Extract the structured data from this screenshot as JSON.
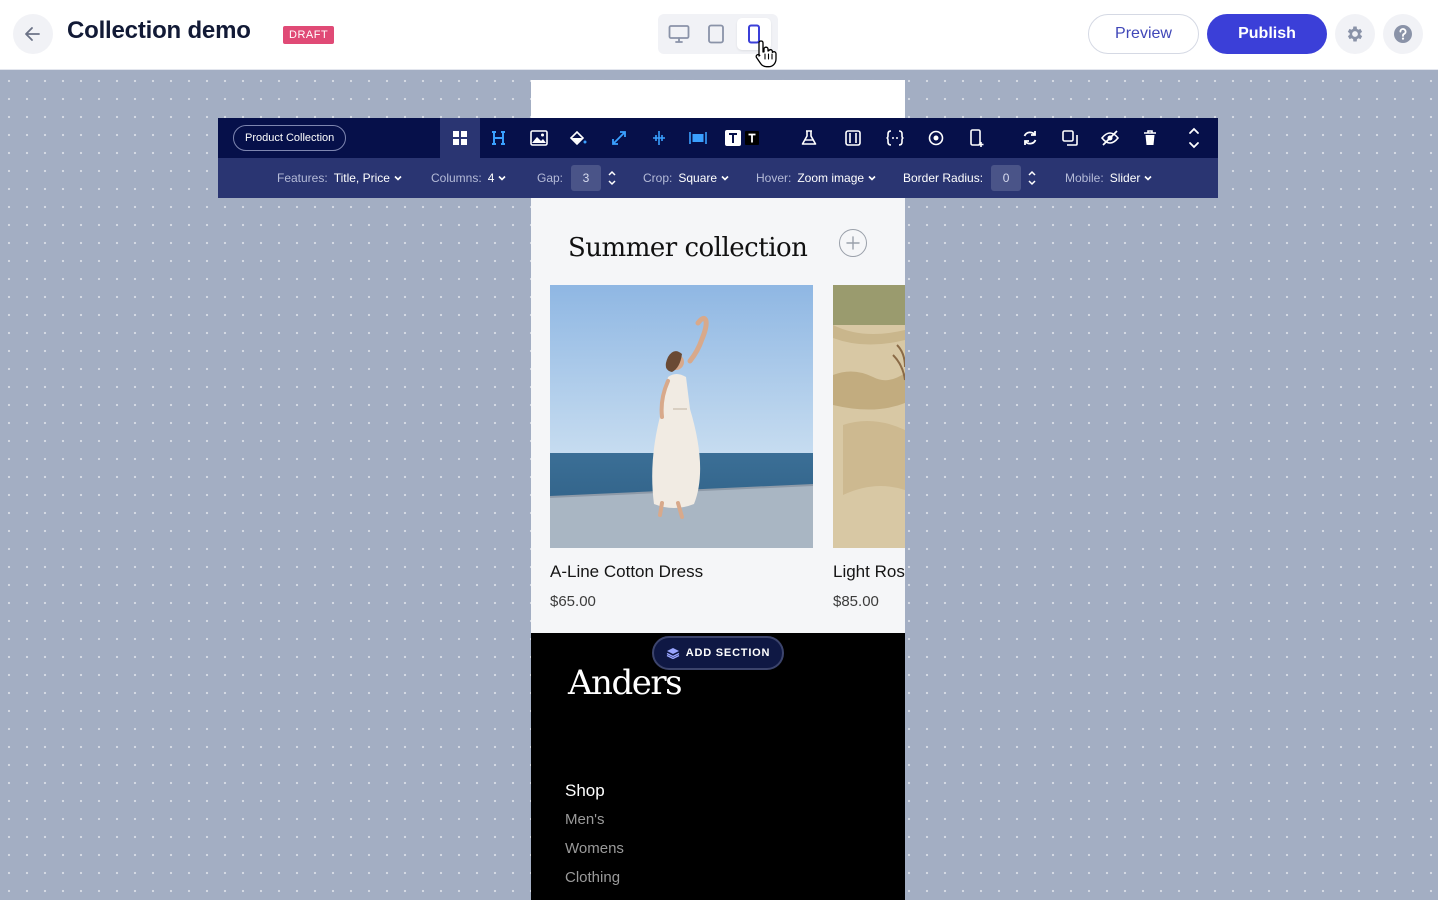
{
  "header": {
    "title": "Collection demo",
    "badge": "DRAFT",
    "preview_label": "Preview",
    "publish_label": "Publish",
    "devices": [
      "desktop-icon",
      "tablet-icon",
      "mobile-icon"
    ],
    "active_device": "mobile"
  },
  "toolbar": {
    "element_name": "Product Collection",
    "settings": {
      "features_label": "Features:",
      "features_value": "Title, Price",
      "columns_label": "Columns:",
      "columns_value": "4",
      "gap_label": "Gap:",
      "gap_value": "3",
      "crop_label": "Crop:",
      "crop_value": "Square",
      "hover_label": "Hover:",
      "hover_value": "Zoom image",
      "radius_label": "Border Radius:",
      "radius_value": "0",
      "mobile_label": "Mobile:",
      "mobile_value": "Slider"
    }
  },
  "collection": {
    "title": "Summer collection",
    "products": [
      {
        "title": "A-Line Cotton Dress",
        "price": "$65.00"
      },
      {
        "title": "Light Ros",
        "price": "$85.00"
      }
    ]
  },
  "add_section_label": "ADD SECTION",
  "footer": {
    "brand": "Anders",
    "heading": "Shop",
    "links": [
      "Men's",
      "Womens",
      "Clothing"
    ]
  },
  "colors": {
    "accent": "#3b3fd8",
    "toolbar_dark": "#06104a",
    "toolbar_light": "#2a3572",
    "draft": "#e04a76"
  }
}
